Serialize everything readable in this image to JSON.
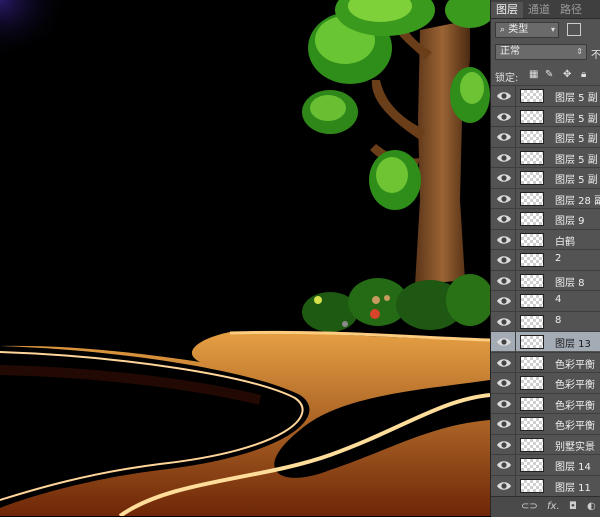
{
  "panel": {
    "tabs": [
      {
        "label": "图层"
      },
      {
        "label": "通道"
      },
      {
        "label": "路径"
      }
    ],
    "filter": {
      "value": "类型"
    },
    "blend_mode": {
      "value": "正常"
    },
    "opacity_label": "不",
    "lock_label": "锁定:",
    "layers": [
      {
        "name": "图层 5 副",
        "visible": true,
        "selected": false
      },
      {
        "name": "图层 5 副",
        "visible": true,
        "selected": false
      },
      {
        "name": "图层 5 副",
        "visible": true,
        "selected": false
      },
      {
        "name": "图层 5 副",
        "visible": true,
        "selected": false
      },
      {
        "name": "图层 5 副",
        "visible": true,
        "selected": false
      },
      {
        "name": "图层 28 副",
        "visible": true,
        "selected": false
      },
      {
        "name": "图层 9",
        "visible": true,
        "selected": false
      },
      {
        "name": "白鹤",
        "visible": true,
        "selected": false
      },
      {
        "name": "2",
        "visible": true,
        "selected": false
      },
      {
        "name": "图层 8",
        "visible": true,
        "selected": false
      },
      {
        "name": "4",
        "visible": true,
        "selected": false
      },
      {
        "name": "8",
        "visible": true,
        "selected": false
      },
      {
        "name": "图层 13",
        "visible": true,
        "selected": true
      },
      {
        "name": "色彩平衡",
        "visible": true,
        "selected": false
      },
      {
        "name": "色彩平衡",
        "visible": true,
        "selected": false
      },
      {
        "name": "色彩平衡",
        "visible": true,
        "selected": false
      },
      {
        "name": "色彩平衡",
        "visible": true,
        "selected": false
      },
      {
        "name": "别墅实景",
        "visible": true,
        "selected": false
      },
      {
        "name": "图层 14",
        "visible": true,
        "selected": false
      },
      {
        "name": "图层 11",
        "visible": true,
        "selected": false
      }
    ],
    "bottom_icons": [
      "link-icon",
      "fx-icon",
      "mask-icon",
      "adjustment-icon"
    ],
    "fx_label": "fx."
  },
  "colors": {
    "panel_bg": "#535353",
    "selected_row": "#a3abb5",
    "river_orange": "#e8881c"
  }
}
